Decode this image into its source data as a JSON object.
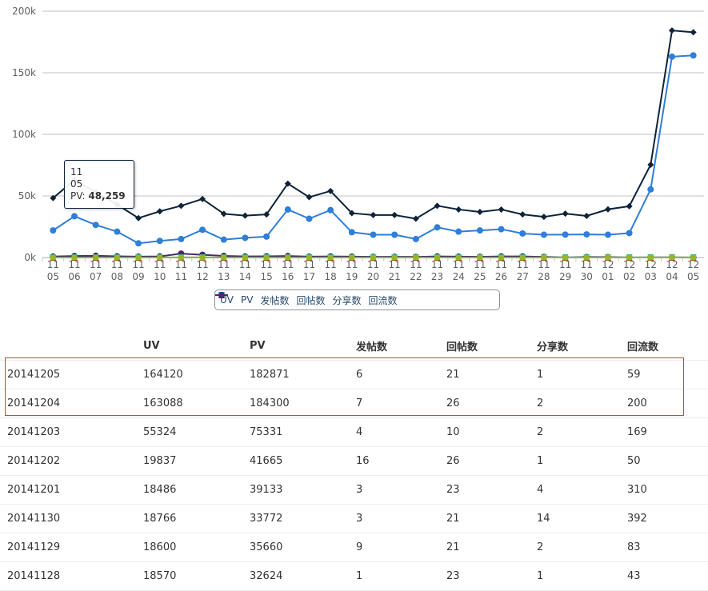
{
  "chart_data": {
    "type": "line",
    "categories": [
      [
        "11",
        "05"
      ],
      [
        "11",
        "06"
      ],
      [
        "11",
        "07"
      ],
      [
        "11",
        "08"
      ],
      [
        "11",
        "09"
      ],
      [
        "11",
        "10"
      ],
      [
        "11",
        "11"
      ],
      [
        "11",
        "12"
      ],
      [
        "11",
        "13"
      ],
      [
        "11",
        "14"
      ],
      [
        "11",
        "15"
      ],
      [
        "11",
        "16"
      ],
      [
        "11",
        "17"
      ],
      [
        "11",
        "18"
      ],
      [
        "11",
        "19"
      ],
      [
        "11",
        "20"
      ],
      [
        "11",
        "21"
      ],
      [
        "11",
        "22"
      ],
      [
        "11",
        "23"
      ],
      [
        "11",
        "24"
      ],
      [
        "11",
        "25"
      ],
      [
        "11",
        "26"
      ],
      [
        "11",
        "27"
      ],
      [
        "11",
        "28"
      ],
      [
        "11",
        "29"
      ],
      [
        "11",
        "30"
      ],
      [
        "12",
        "01"
      ],
      [
        "12",
        "02"
      ],
      [
        "12",
        "03"
      ],
      [
        "12",
        "04"
      ],
      [
        "12",
        "05"
      ]
    ],
    "ylim": [
      0,
      200000
    ],
    "yticks": [
      0,
      50000,
      100000,
      150000,
      200000
    ],
    "ytick_labels": [
      "0k",
      "50k",
      "100k",
      "150k",
      "200k"
    ],
    "grid": true,
    "legend_position": "bottom-center",
    "series": [
      {
        "name": "UV",
        "color": "#2f7ed8",
        "marker": "circle",
        "values": [
          22000,
          33500,
          26500,
          21000,
          11500,
          13500,
          15000,
          22500,
          14500,
          16000,
          17000,
          39000,
          31500,
          38500,
          20500,
          18500,
          18500,
          15000,
          24500,
          21000,
          22000,
          23000,
          19500,
          18486,
          18600,
          18766,
          18486,
          19837,
          55324,
          163088,
          164120
        ]
      },
      {
        "name": "PV",
        "color": "#0d233a",
        "marker": "diamond",
        "values": [
          48259,
          63000,
          53000,
          43000,
          32000,
          37500,
          42000,
          47500,
          35500,
          34000,
          35000,
          60000,
          49000,
          54000,
          36000,
          34500,
          34500,
          31500,
          42000,
          39000,
          37000,
          39000,
          35000,
          33000,
          35660,
          33772,
          39133,
          41665,
          75331,
          184300,
          182871
        ]
      },
      {
        "name": "发帖数",
        "color": "#8bbc21",
        "marker": "square",
        "values": [
          8,
          12,
          10,
          6,
          5,
          7,
          14,
          9,
          6,
          5,
          6,
          7,
          4,
          6,
          5,
          5,
          4,
          3,
          6,
          5,
          4,
          6,
          3,
          2,
          9,
          3,
          3,
          16,
          4,
          7,
          6
        ]
      },
      {
        "name": "回帖数",
        "color": "#910000",
        "marker": "triangle",
        "values": [
          30,
          40,
          35,
          25,
          20,
          22,
          60,
          45,
          25,
          20,
          25,
          30,
          20,
          25,
          22,
          20,
          20,
          18,
          25,
          22,
          20,
          25,
          18,
          15,
          21,
          21,
          23,
          26,
          10,
          26,
          21
        ]
      },
      {
        "name": "分享数",
        "color": "#1aadce",
        "marker": "triangle-down",
        "values": [
          3,
          5,
          4,
          2,
          2,
          3,
          6,
          4,
          2,
          2,
          3,
          4,
          2,
          3,
          2,
          2,
          2,
          1,
          3,
          2,
          2,
          3,
          2,
          1,
          2,
          14,
          4,
          1,
          2,
          2,
          1
        ]
      },
      {
        "name": "回流数",
        "color": "#492970",
        "marker": "circle",
        "values": [
          800,
          1200,
          1400,
          1000,
          700,
          900,
          3200,
          2200,
          1300,
          900,
          1000,
          1200,
          700,
          900,
          700,
          600,
          600,
          500,
          900,
          700,
          600,
          900,
          900,
          500,
          83,
          392,
          310,
          50,
          169,
          200,
          59
        ]
      }
    ]
  },
  "tooltip": {
    "line1": "11",
    "line2": "05",
    "series": "PV:",
    "value": "48,259"
  },
  "table": {
    "headers": [
      "",
      "UV",
      "PV",
      "发帖数",
      "回帖数",
      "分享数",
      "回流数"
    ],
    "rows": [
      [
        "20141205",
        "164120",
        "182871",
        "6",
        "21",
        "1",
        "59"
      ],
      [
        "20141204",
        "163088",
        "184300",
        "7",
        "26",
        "2",
        "200"
      ],
      [
        "20141203",
        "55324",
        "75331",
        "4",
        "10",
        "2",
        "169"
      ],
      [
        "20141202",
        "19837",
        "41665",
        "16",
        "26",
        "1",
        "50"
      ],
      [
        "20141201",
        "18486",
        "39133",
        "3",
        "23",
        "4",
        "310"
      ],
      [
        "20141130",
        "18766",
        "33772",
        "3",
        "21",
        "14",
        "392"
      ],
      [
        "20141129",
        "18600",
        "35660",
        "9",
        "21",
        "2",
        "83"
      ],
      [
        "20141128",
        "18570",
        "32624",
        "1",
        "23",
        "1",
        "43"
      ]
    ]
  }
}
